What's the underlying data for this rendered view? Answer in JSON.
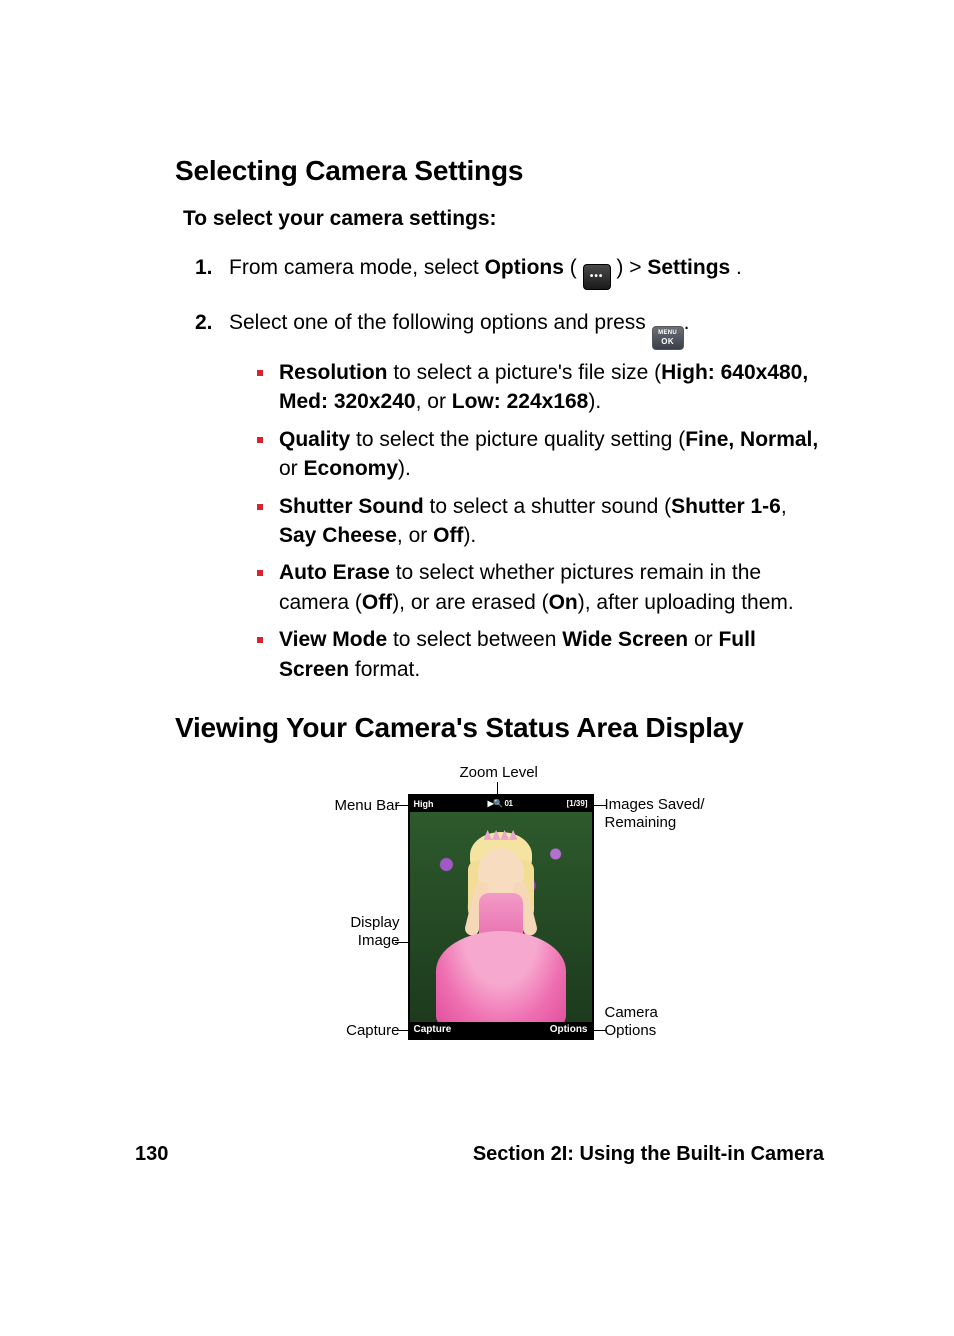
{
  "headings": {
    "h1": "Selecting Camera Settings",
    "sub1": "To select your camera settings:",
    "h2": "Viewing Your Camera's Status Area Display"
  },
  "steps": {
    "s1": {
      "num": "1.",
      "pre": "From camera mode, select ",
      "b1": "Options",
      "mid": " ( ",
      "mid2": " ) > ",
      "b2": "Settings",
      "post": " ."
    },
    "s2": {
      "num": "2.",
      "pre": "Select one of the following options and press ",
      "post": "."
    }
  },
  "bullets": {
    "resolution": {
      "b1": "Resolution",
      "t1": " to select a picture's file size (",
      "b2": "High: 640x480, Med: 320x240",
      "t2": ", or ",
      "b3": "Low: 224x168",
      "t3": ")."
    },
    "quality": {
      "b1": "Quality",
      "t1": " to select the picture quality setting (",
      "b2": "Fine, Normal,",
      "t2": " or ",
      "b3": "Economy",
      "t3": ")."
    },
    "shutter": {
      "b1": "Shutter Sound",
      "t1": " to select a shutter sound (",
      "b2": "Shutter 1-6",
      "t2": ", ",
      "b3": "Say Cheese",
      "t3": ", or ",
      "b4": "Off",
      "t4": ")."
    },
    "autoerase": {
      "b1": "Auto Erase",
      "t1": " to select whether pictures remain in the camera (",
      "b2": "Off",
      "t2": "), or are erased (",
      "b3": "On",
      "t3": "), after uploading them."
    },
    "viewmode": {
      "b1": "View Mode",
      "t1": " to select between ",
      "b2": "Wide Screen",
      "t2": " or ",
      "b3": "Full Screen",
      "t3": " format."
    }
  },
  "diagram": {
    "labels": {
      "zoom": "Zoom Level",
      "menubar": "Menu Bar",
      "saved1": "Images Saved/",
      "saved2": "Remaining",
      "display1": "Display",
      "display2": "Image",
      "capture": "Capture",
      "opts1": "Camera",
      "opts2": "Options"
    },
    "status": {
      "res": "High",
      "zoom_indicator": "▶🔍 01",
      "counter": "[1/39]"
    },
    "softkeys": {
      "left": "Capture",
      "right": "Options"
    }
  },
  "footer": {
    "page": "130",
    "section": "Section 2I: Using the Built-in Camera"
  }
}
